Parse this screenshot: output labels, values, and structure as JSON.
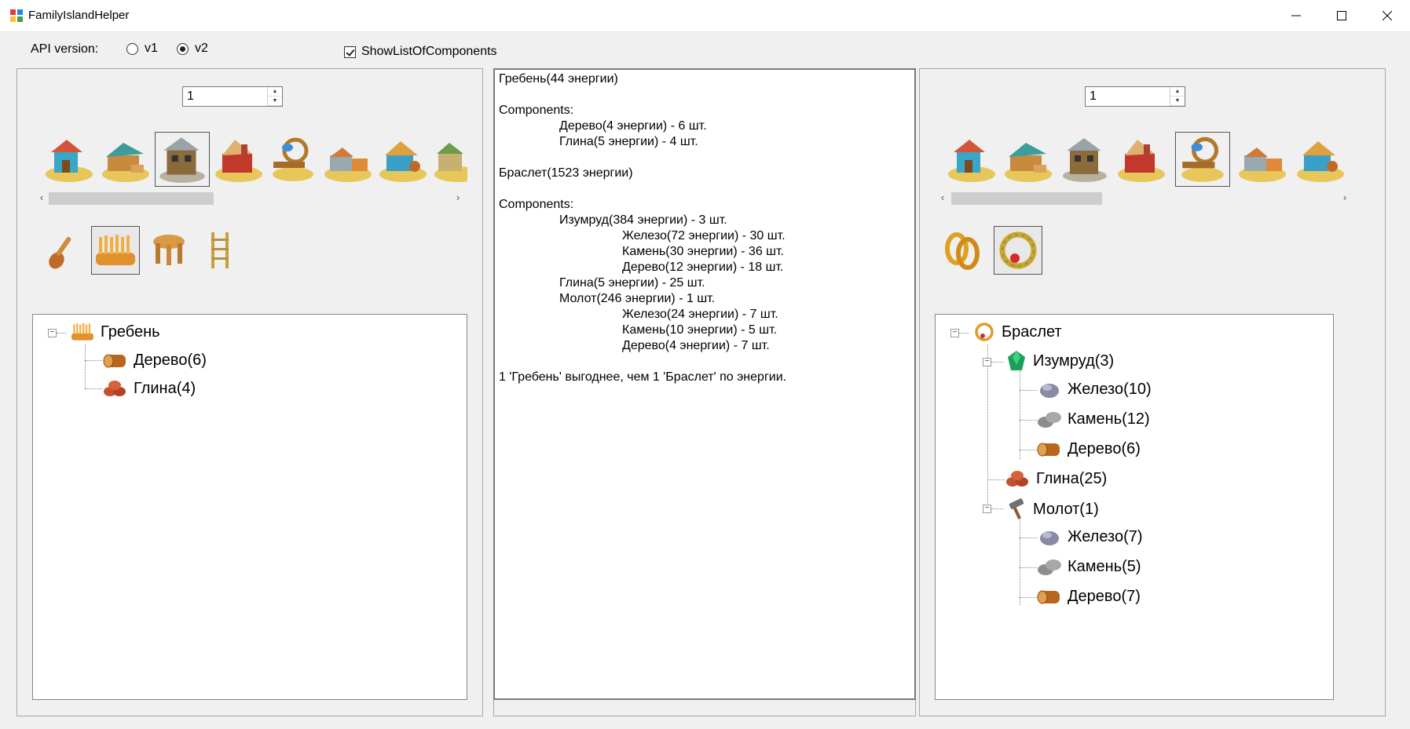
{
  "window": {
    "title": "FamilyIslandHelper"
  },
  "top": {
    "api_label": "API version:",
    "v1_label": "v1",
    "v2_label": "v2",
    "v2_selected": true,
    "show_list_label": "ShowListOfComponents",
    "show_list_checked": true
  },
  "left": {
    "quantity": "1",
    "buildings": [
      "building-1-icon",
      "building-2-icon",
      "building-3-icon",
      "building-4-icon",
      "building-5-icon",
      "building-6-icon",
      "building-7-icon",
      "building-8-icon"
    ],
    "selected_building": 3,
    "items": [
      "spoon-icon",
      "comb-icon",
      "stool-icon",
      "ladder-icon"
    ],
    "selected_item": 2,
    "tree": {
      "root": "Гребень",
      "children": [
        "Дерево(6)",
        "Глина(4)"
      ]
    }
  },
  "middle": {
    "lines": [
      "Гребень(44 энергии)",
      "",
      "Components:",
      "Дерево(4 энергии) - 6 шт.",
      "Глина(5 энергии) - 4 шт.",
      "",
      "Браслет(1523 энергии)",
      "",
      "Components:",
      "Изумруд(384 энергии) - 3 шт.",
      "Железо(72 энергии) - 30 шт.",
      "Камень(30 энергии) - 36 шт.",
      "Дерево(12 энергии) - 18 шт.",
      "Глина(5 энергии) - 25 шт.",
      "Молот(246 энергии) - 1 шт.",
      "Железо(24 энергии) - 7 шт.",
      "Камень(10 энергии) - 5 шт.",
      "Дерево(4 энергии) - 7 шт.",
      "",
      "1 'Гребень' выгоднее, чем 1 'Браслет' по энергии."
    ]
  },
  "right": {
    "quantity": "1",
    "selected_building": 5,
    "items": [
      "rings-icon",
      "bracelet-icon"
    ],
    "selected_item": 2,
    "tree": {
      "root": "Браслет",
      "emerald": "Изумруд(3)",
      "emerald_children": [
        "Железо(10)",
        "Камень(12)",
        "Дерево(6)"
      ],
      "clay": "Глина(25)",
      "hammer": "Молот(1)",
      "hammer_children": [
        "Железо(7)",
        "Камень(5)",
        "Дерево(7)"
      ]
    }
  },
  "colors": {
    "accent": "#0078d7",
    "wood": "#b8661e",
    "clay": "#c4502e",
    "emerald": "#1aa05a"
  }
}
